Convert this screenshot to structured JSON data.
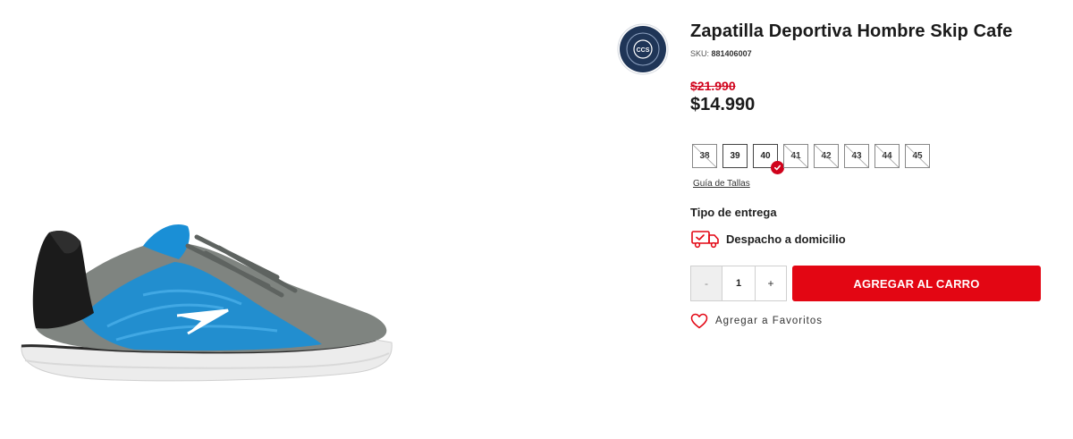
{
  "product": {
    "title": "Zapatilla Deportiva Hombre Skip Cafe",
    "sku_label": "SKU:",
    "sku_value": "881406007",
    "old_price": "$21.990",
    "price": "$14.990",
    "image_icon": "sneaker-image"
  },
  "badge": {
    "icon": "ccs-certified-seal-icon",
    "text_top": "EMPRESA CERTIFICADA",
    "text_center": "CCS"
  },
  "sizes": [
    {
      "label": "38",
      "available": false,
      "selected": false
    },
    {
      "label": "39",
      "available": true,
      "selected": false
    },
    {
      "label": "40",
      "available": true,
      "selected": true
    },
    {
      "label": "41",
      "available": false,
      "selected": false
    },
    {
      "label": "42",
      "available": false,
      "selected": false
    },
    {
      "label": "43",
      "available": false,
      "selected": false
    },
    {
      "label": "44",
      "available": false,
      "selected": false
    },
    {
      "label": "45",
      "available": false,
      "selected": false
    }
  ],
  "size_guide": "Guía de Tallas",
  "delivery": {
    "heading": "Tipo de entrega",
    "option_label": "Despacho a domicilio",
    "icon": "delivery-truck-icon"
  },
  "quantity": {
    "minus": "-",
    "value": "1",
    "plus": "+"
  },
  "actions": {
    "add_to_cart": "AGREGAR AL CARRO",
    "add_to_favorites": "Agregar a Favoritos",
    "favorites_icon": "heart-icon"
  },
  "colors": {
    "accent": "#e30613",
    "old_price": "#d0021b",
    "shoe_blue": "#1a8fd6",
    "shoe_gray": "#7f8480"
  }
}
